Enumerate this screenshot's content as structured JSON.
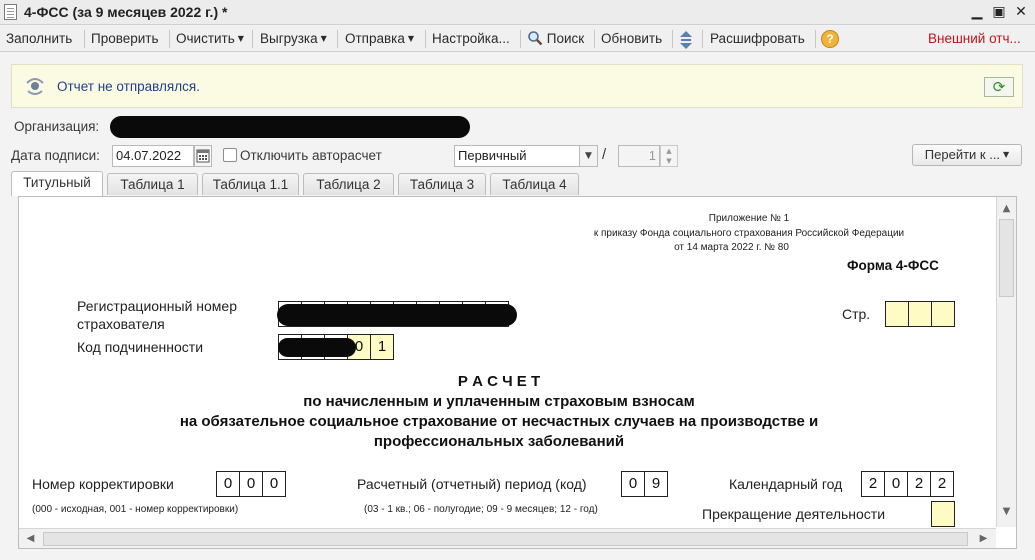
{
  "window": {
    "title": "4-ФСС (за 9 месяцев 2022 г.) *"
  },
  "toolbar": {
    "fill": "Заполнить",
    "check": "Проверить",
    "clear": "Очистить",
    "export": "Выгрузка",
    "send": "Отправка",
    "settings": "Настройка...",
    "search": "Поиск",
    "refresh": "Обновить",
    "decode": "Расшифровать",
    "external": "Внешний отч..."
  },
  "status": {
    "text": "Отчет не отправлялся."
  },
  "form": {
    "org_label": "Организация:",
    "date_label": "Дата подписи:",
    "date_value": "04.07.2022",
    "autocalc_label": "Отключить авторасчет",
    "type_value": "Первичный",
    "slash": "/",
    "number_value": "1",
    "goto_label": "Перейти к ..."
  },
  "tabs": [
    "Титульный",
    "Таблица 1",
    "Таблица 1.1",
    "Таблица 2",
    "Таблица 3",
    "Таблица 4"
  ],
  "doc": {
    "appendix_line1": "Приложение № 1",
    "appendix_line2": "к приказу Фонда социального страхования Российской Федерации",
    "appendix_line3": "от 14 марта 2022 г. № 80",
    "form_name": "Форма 4-ФСС",
    "reg_label_1": "Регистрационный номер",
    "reg_label_2": "страхователя",
    "page_label": "Стр.",
    "sub_code_label": "Код подчиненности",
    "sub_code_tail": [
      "0",
      "1"
    ],
    "heading_1": "Р А С Ч Е Т",
    "heading_2": "по начисленным и уплаченным страховым взносам",
    "heading_3": "на обязательное социальное страхование от несчастных случаев на производстве и",
    "heading_4": "профессиональных заболеваний",
    "correction_label": "Номер корректировки",
    "correction_digits": [
      "0",
      "0",
      "0"
    ],
    "correction_hint": "(000 - исходная, 001 - номер корректировки)",
    "period_label": "Расчетный (отчетный) период  (код)",
    "period_digits": [
      "0",
      "9"
    ],
    "period_hint": "(03 - 1 кв.; 06 - полугодие; 09 - 9 месяцев; 12 - год)",
    "year_label": "Календарный год",
    "year_digits": [
      "2",
      "0",
      "2",
      "2"
    ],
    "termination_label": "Прекращение деятельности"
  },
  "colors": {
    "accent_red": "#c0141a",
    "status_blue": "#1f3f8f",
    "cell_yellow": "#fffbc4"
  }
}
